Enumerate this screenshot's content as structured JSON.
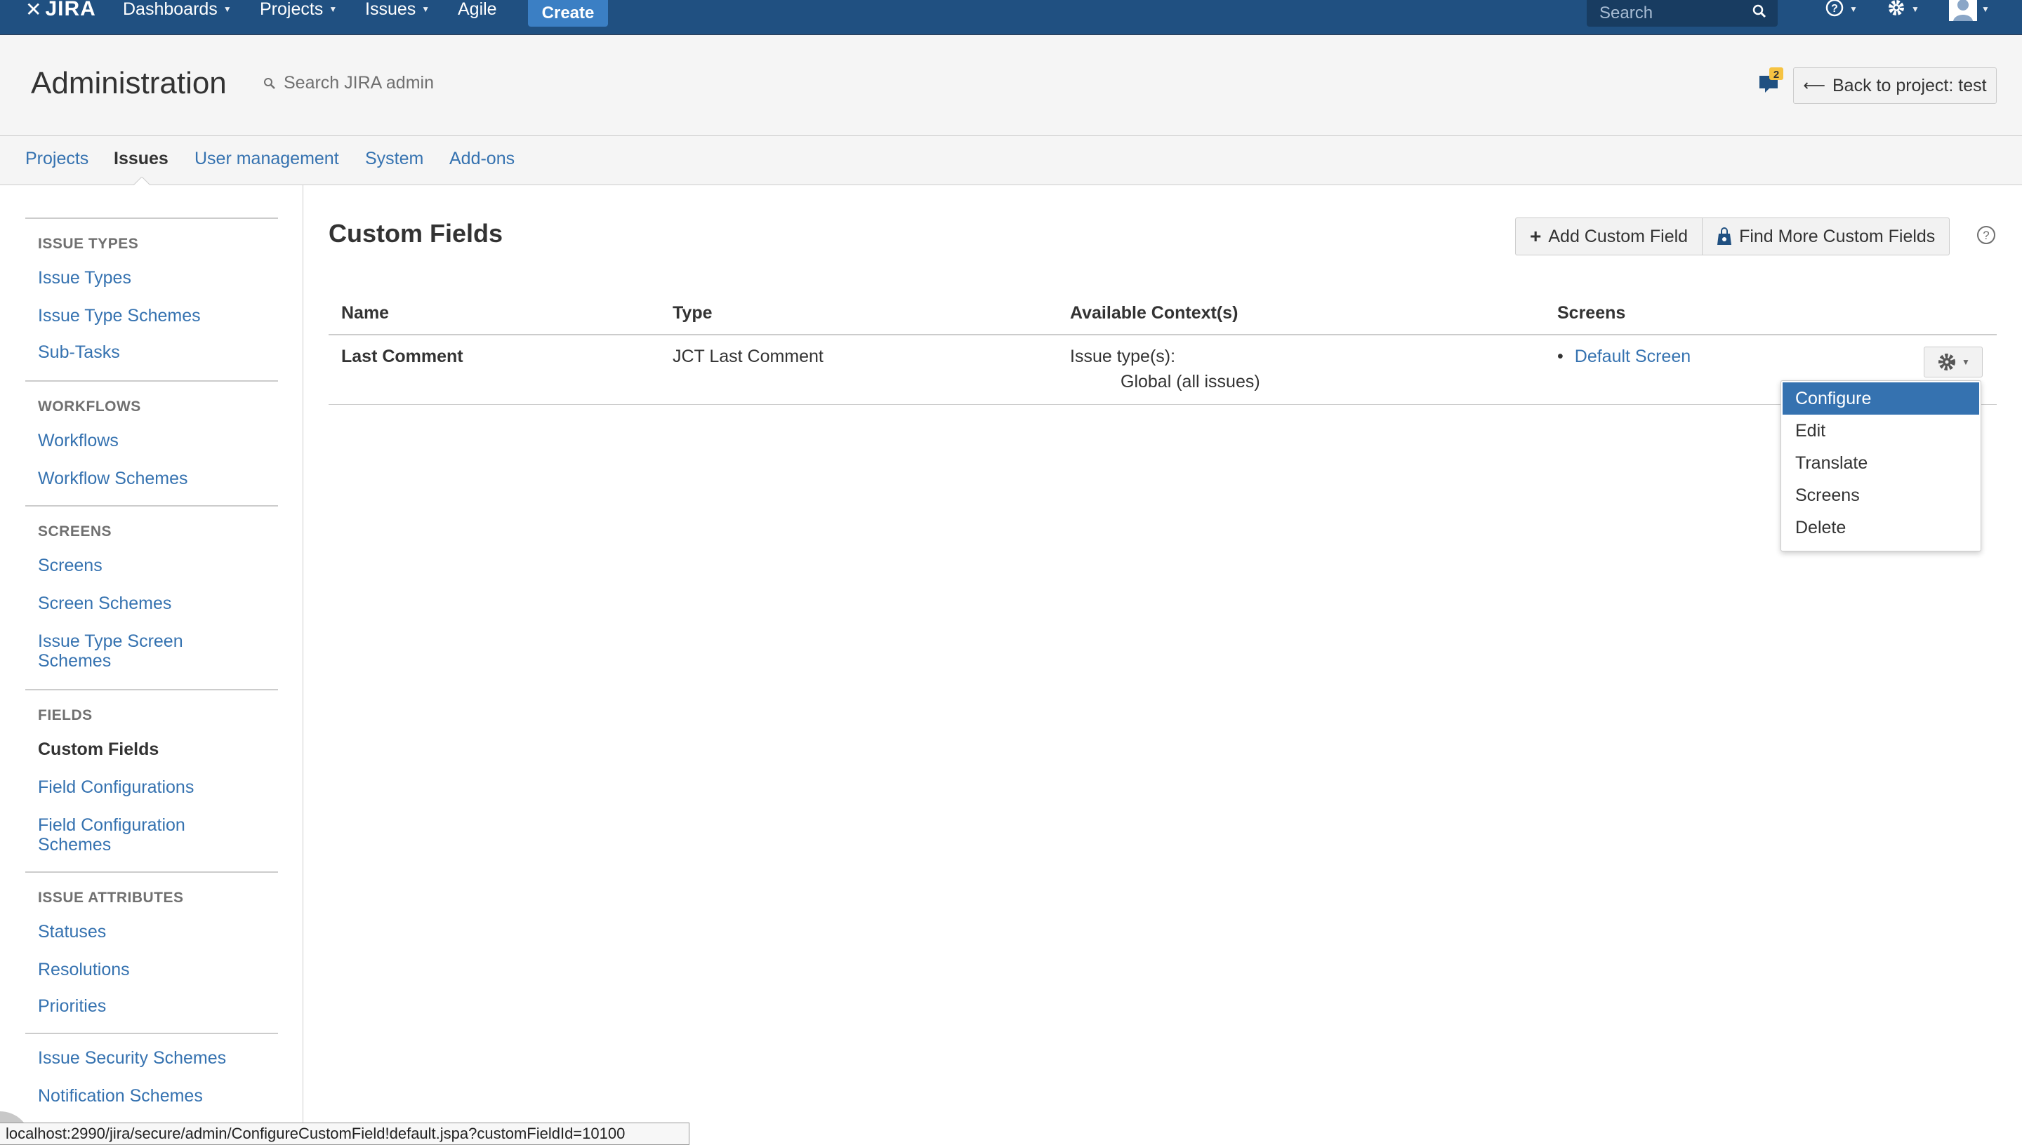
{
  "topnav": {
    "logo": "JIRA",
    "items": [
      "Dashboards",
      "Projects",
      "Issues",
      "Agile"
    ],
    "create": "Create",
    "search_placeholder": "Search"
  },
  "admin": {
    "title": "Administration",
    "search": "Search JIRA admin",
    "notification_count": "2",
    "back": "Back to project: test"
  },
  "tabs": [
    "Projects",
    "Issues",
    "User management",
    "System",
    "Add-ons"
  ],
  "sidebar": {
    "sections": [
      {
        "head": "ISSUE TYPES",
        "links": [
          "Issue Types",
          "Issue Type Schemes",
          "Sub-Tasks"
        ]
      },
      {
        "head": "WORKFLOWS",
        "links": [
          "Workflows",
          "Workflow Schemes"
        ]
      },
      {
        "head": "SCREENS",
        "links": [
          "Screens",
          "Screen Schemes",
          "Issue Type Screen Schemes"
        ]
      },
      {
        "head": "FIELDS",
        "links": [
          "Custom Fields",
          "Field Configurations",
          "Field Configuration Schemes"
        ]
      },
      {
        "head": "ISSUE ATTRIBUTES",
        "links": [
          "Statuses",
          "Resolutions",
          "Priorities"
        ]
      },
      {
        "head": "",
        "links": [
          "Issue Security Schemes",
          "Notification Schemes"
        ]
      }
    ]
  },
  "main": {
    "title": "Custom Fields",
    "add_button": "Add Custom Field",
    "find_button": "Find More Custom Fields",
    "columns": [
      "Name",
      "Type",
      "Available Context(s)",
      "Screens"
    ],
    "rows": [
      {
        "name": "Last Comment",
        "type": "JCT Last Comment",
        "context_label": "Issue type(s):",
        "context_value": "Global (all issues)",
        "screen": "Default Screen"
      }
    ],
    "menu": [
      "Configure",
      "Edit",
      "Translate",
      "Screens",
      "Delete"
    ]
  },
  "statusbar": "localhost:2990/jira/secure/admin/ConfigureCustomField!default.jspa?customFieldId=10100",
  "colors": {
    "nav": "#205081",
    "link": "#3572b0",
    "create": "#3b7fc4",
    "highlight": "#3572b0"
  }
}
